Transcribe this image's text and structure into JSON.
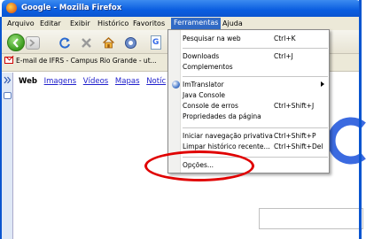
{
  "window": {
    "title": "Google - Mozilla Firefox"
  },
  "menubar": {
    "items": [
      {
        "label": "Arquivo"
      },
      {
        "label": "Editar"
      },
      {
        "label": "Exibir"
      },
      {
        "label": "Histórico"
      },
      {
        "label": "Favoritos"
      },
      {
        "label": "Ferramentas"
      },
      {
        "label": "Ajuda"
      }
    ]
  },
  "bookmarks": {
    "gmail_tab": "E-mail de IFRS - Campus Rio Grande - ut..."
  },
  "content": {
    "links": [
      "Web",
      "Imagens",
      "Vídeos",
      "Mapas",
      "Notíc"
    ]
  },
  "dropdown": {
    "items": [
      {
        "label": "Pesquisar na web",
        "shortcut": "Ctrl+K"
      },
      {
        "label": "Downloads",
        "shortcut": "Ctrl+J"
      },
      {
        "label": "Complementos",
        "shortcut": ""
      },
      {
        "label": "ImTranslator",
        "shortcut": ""
      },
      {
        "label": "Java Console",
        "shortcut": ""
      },
      {
        "label": "Console de erros",
        "shortcut": "Ctrl+Shift+J"
      },
      {
        "label": "Propriedades da página",
        "shortcut": ""
      },
      {
        "label": "Iniciar navegação privativa",
        "shortcut": "Ctrl+Shift+P"
      },
      {
        "label": "Limpar histórico recente...",
        "shortcut": "Ctrl+Shift+Del"
      },
      {
        "label": "Opções...",
        "shortcut": ""
      }
    ]
  },
  "colors": {
    "highlight": "#e00000",
    "menu_active": "#316ac5",
    "titlebar": "#0a5de0"
  }
}
